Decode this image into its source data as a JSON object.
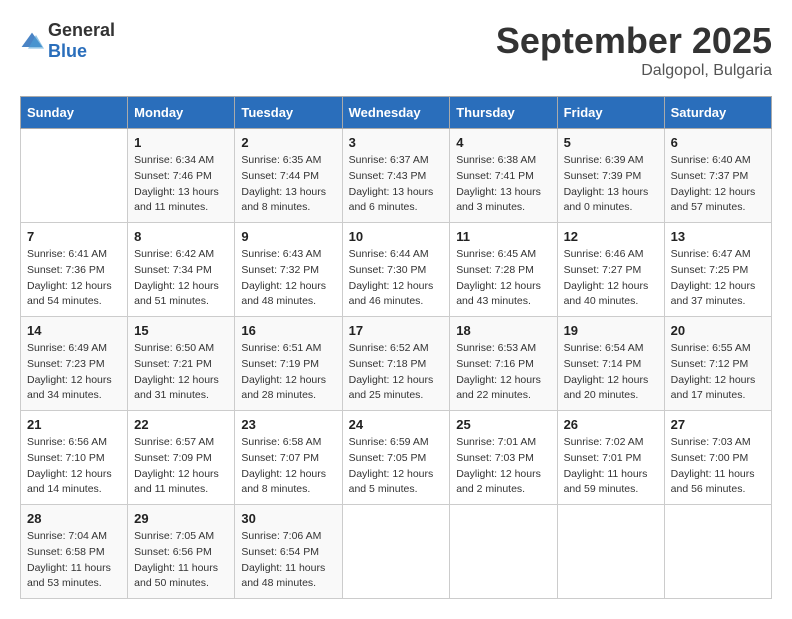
{
  "logo": {
    "general": "General",
    "blue": "Blue"
  },
  "header": {
    "month": "September 2025",
    "location": "Dalgopol, Bulgaria"
  },
  "weekdays": [
    "Sunday",
    "Monday",
    "Tuesday",
    "Wednesday",
    "Thursday",
    "Friday",
    "Saturday"
  ],
  "weeks": [
    [
      {
        "day": "",
        "sunrise": "",
        "sunset": "",
        "daylight": ""
      },
      {
        "day": "1",
        "sunrise": "Sunrise: 6:34 AM",
        "sunset": "Sunset: 7:46 PM",
        "daylight": "Daylight: 13 hours and 11 minutes."
      },
      {
        "day": "2",
        "sunrise": "Sunrise: 6:35 AM",
        "sunset": "Sunset: 7:44 PM",
        "daylight": "Daylight: 13 hours and 8 minutes."
      },
      {
        "day": "3",
        "sunrise": "Sunrise: 6:37 AM",
        "sunset": "Sunset: 7:43 PM",
        "daylight": "Daylight: 13 hours and 6 minutes."
      },
      {
        "day": "4",
        "sunrise": "Sunrise: 6:38 AM",
        "sunset": "Sunset: 7:41 PM",
        "daylight": "Daylight: 13 hours and 3 minutes."
      },
      {
        "day": "5",
        "sunrise": "Sunrise: 6:39 AM",
        "sunset": "Sunset: 7:39 PM",
        "daylight": "Daylight: 13 hours and 0 minutes."
      },
      {
        "day": "6",
        "sunrise": "Sunrise: 6:40 AM",
        "sunset": "Sunset: 7:37 PM",
        "daylight": "Daylight: 12 hours and 57 minutes."
      }
    ],
    [
      {
        "day": "7",
        "sunrise": "Sunrise: 6:41 AM",
        "sunset": "Sunset: 7:36 PM",
        "daylight": "Daylight: 12 hours and 54 minutes."
      },
      {
        "day": "8",
        "sunrise": "Sunrise: 6:42 AM",
        "sunset": "Sunset: 7:34 PM",
        "daylight": "Daylight: 12 hours and 51 minutes."
      },
      {
        "day": "9",
        "sunrise": "Sunrise: 6:43 AM",
        "sunset": "Sunset: 7:32 PM",
        "daylight": "Daylight: 12 hours and 48 minutes."
      },
      {
        "day": "10",
        "sunrise": "Sunrise: 6:44 AM",
        "sunset": "Sunset: 7:30 PM",
        "daylight": "Daylight: 12 hours and 46 minutes."
      },
      {
        "day": "11",
        "sunrise": "Sunrise: 6:45 AM",
        "sunset": "Sunset: 7:28 PM",
        "daylight": "Daylight: 12 hours and 43 minutes."
      },
      {
        "day": "12",
        "sunrise": "Sunrise: 6:46 AM",
        "sunset": "Sunset: 7:27 PM",
        "daylight": "Daylight: 12 hours and 40 minutes."
      },
      {
        "day": "13",
        "sunrise": "Sunrise: 6:47 AM",
        "sunset": "Sunset: 7:25 PM",
        "daylight": "Daylight: 12 hours and 37 minutes."
      }
    ],
    [
      {
        "day": "14",
        "sunrise": "Sunrise: 6:49 AM",
        "sunset": "Sunset: 7:23 PM",
        "daylight": "Daylight: 12 hours and 34 minutes."
      },
      {
        "day": "15",
        "sunrise": "Sunrise: 6:50 AM",
        "sunset": "Sunset: 7:21 PM",
        "daylight": "Daylight: 12 hours and 31 minutes."
      },
      {
        "day": "16",
        "sunrise": "Sunrise: 6:51 AM",
        "sunset": "Sunset: 7:19 PM",
        "daylight": "Daylight: 12 hours and 28 minutes."
      },
      {
        "day": "17",
        "sunrise": "Sunrise: 6:52 AM",
        "sunset": "Sunset: 7:18 PM",
        "daylight": "Daylight: 12 hours and 25 minutes."
      },
      {
        "day": "18",
        "sunrise": "Sunrise: 6:53 AM",
        "sunset": "Sunset: 7:16 PM",
        "daylight": "Daylight: 12 hours and 22 minutes."
      },
      {
        "day": "19",
        "sunrise": "Sunrise: 6:54 AM",
        "sunset": "Sunset: 7:14 PM",
        "daylight": "Daylight: 12 hours and 20 minutes."
      },
      {
        "day": "20",
        "sunrise": "Sunrise: 6:55 AM",
        "sunset": "Sunset: 7:12 PM",
        "daylight": "Daylight: 12 hours and 17 minutes."
      }
    ],
    [
      {
        "day": "21",
        "sunrise": "Sunrise: 6:56 AM",
        "sunset": "Sunset: 7:10 PM",
        "daylight": "Daylight: 12 hours and 14 minutes."
      },
      {
        "day": "22",
        "sunrise": "Sunrise: 6:57 AM",
        "sunset": "Sunset: 7:09 PM",
        "daylight": "Daylight: 12 hours and 11 minutes."
      },
      {
        "day": "23",
        "sunrise": "Sunrise: 6:58 AM",
        "sunset": "Sunset: 7:07 PM",
        "daylight": "Daylight: 12 hours and 8 minutes."
      },
      {
        "day": "24",
        "sunrise": "Sunrise: 6:59 AM",
        "sunset": "Sunset: 7:05 PM",
        "daylight": "Daylight: 12 hours and 5 minutes."
      },
      {
        "day": "25",
        "sunrise": "Sunrise: 7:01 AM",
        "sunset": "Sunset: 7:03 PM",
        "daylight": "Daylight: 12 hours and 2 minutes."
      },
      {
        "day": "26",
        "sunrise": "Sunrise: 7:02 AM",
        "sunset": "Sunset: 7:01 PM",
        "daylight": "Daylight: 11 hours and 59 minutes."
      },
      {
        "day": "27",
        "sunrise": "Sunrise: 7:03 AM",
        "sunset": "Sunset: 7:00 PM",
        "daylight": "Daylight: 11 hours and 56 minutes."
      }
    ],
    [
      {
        "day": "28",
        "sunrise": "Sunrise: 7:04 AM",
        "sunset": "Sunset: 6:58 PM",
        "daylight": "Daylight: 11 hours and 53 minutes."
      },
      {
        "day": "29",
        "sunrise": "Sunrise: 7:05 AM",
        "sunset": "Sunset: 6:56 PM",
        "daylight": "Daylight: 11 hours and 50 minutes."
      },
      {
        "day": "30",
        "sunrise": "Sunrise: 7:06 AM",
        "sunset": "Sunset: 6:54 PM",
        "daylight": "Daylight: 11 hours and 48 minutes."
      },
      {
        "day": "",
        "sunrise": "",
        "sunset": "",
        "daylight": ""
      },
      {
        "day": "",
        "sunrise": "",
        "sunset": "",
        "daylight": ""
      },
      {
        "day": "",
        "sunrise": "",
        "sunset": "",
        "daylight": ""
      },
      {
        "day": "",
        "sunrise": "",
        "sunset": "",
        "daylight": ""
      }
    ]
  ]
}
